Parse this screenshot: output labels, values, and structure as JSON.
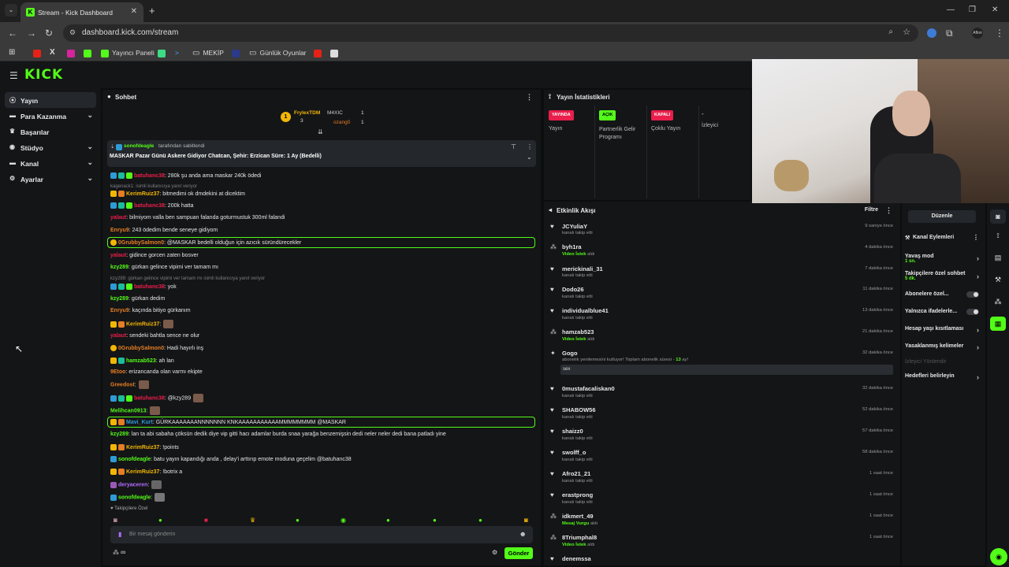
{
  "browser": {
    "tab_title": "Stream - Kick Dashboard",
    "url": "dashboard.kick.com/stream",
    "bookmarks": [
      "Yayıncı Paneli",
      "MEKİP",
      "Günlük Oyunlar"
    ]
  },
  "brand": {
    "logo": "KICK",
    "accent": "#53fc18"
  },
  "sidebar": {
    "items": [
      {
        "label": "Yayın",
        "icon": "broadcast-icon"
      },
      {
        "label": "Para Kazanma",
        "icon": "dollar-icon"
      },
      {
        "label": "Başarılar",
        "icon": "trophy-icon"
      },
      {
        "label": "Stüdyo",
        "icon": "studio-icon"
      },
      {
        "label": "Kanal",
        "icon": "channel-icon"
      },
      {
        "label": "Ayarlar",
        "icon": "gear-icon"
      }
    ]
  },
  "chat": {
    "title": "Sohbet",
    "leaderboard": [
      {
        "name": "FrylexTDM",
        "count": "3"
      },
      {
        "name": "M4XIC",
        "count": "1"
      },
      {
        "name": "ozang0",
        "count": "1"
      }
    ],
    "pinned": {
      "by": "sonofdeagle",
      "by_suffix": "tarafından sabitlendi",
      "text": "MASKAR Pazar Günü Askere Gidiyor Chatcan, Şehir: Erzican Süre: 1 Ay (Bedelli)"
    },
    "messages": [
      {
        "user": "batuhanc38",
        "text": ": 280k şu anda ama maskar 240k ödedi"
      },
      {
        "reply": "kagenack1: isimli kullanıcıya yanıt veriyor"
      },
      {
        "user": "KerimRuiz37",
        "text": ": bitmedimi ok dmdekini at dicektim"
      },
      {
        "user": "batuhanc38",
        "text": ": 200k hatta"
      },
      {
        "user": "yalaut",
        "text": ": bilmiyom valla ben sampuan falanda goturmustuk 300ml falandi"
      },
      {
        "user": "Enryu9",
        "text": ": 243 ödedim bende seneye gidiyom"
      },
      {
        "user": "0GrubbySalmon0",
        "text": ": @MASKAR bedelli olduğun için azıcık süründürecekler"
      },
      {
        "user": "yalaut",
        "text": ": gidince gorcen zaten bosver"
      },
      {
        "user": "kzy289",
        "text": ": gürkan gelince vipimi ver tamam mı"
      },
      {
        "reply": "kzy289: gürkan gelince vipimi ver tamam mı isimli kullanıcıya yanıt veriyor"
      },
      {
        "user": "batuhanc38",
        "text": ": yok"
      },
      {
        "user": "kzy289",
        "text": ": gürkan dedim"
      },
      {
        "user": "Enryu9",
        "text": ": kaçında bitiyo gürkanım"
      },
      {
        "user": "KerimRuiz37",
        "text": ":"
      },
      {
        "user": "yalaut",
        "text": ": sendeki bahtla sence ne olur"
      },
      {
        "user": "0GrubbySalmon0",
        "text": ": Hadi hayırlı inş"
      },
      {
        "user": "hamzab523",
        "text": ": ah lan"
      },
      {
        "user": "9Etoo",
        "text": ": erizancanda olan varmı ekipte"
      },
      {
        "user": "Greedost",
        "text": ":"
      },
      {
        "user": "batuhanc38",
        "text": ": @kzy289"
      },
      {
        "user": "Melihcan0913",
        "text": ":"
      },
      {
        "user": "Mavi_Kurt",
        "text": ": GÜRKAAAAAAANNNNNNN KNKAAAAAAAAAAAMMMMMMMM @MASKAR"
      },
      {
        "user": "kzy289",
        "text": ": lan ta abi sabaha çöksün dedik diye vip gitti hacı adamlar burda snaa yarağa benzemişsin dedi neler neler dedi bana patladı yine"
      },
      {
        "user": "KerimRuiz37",
        "text": ": !points"
      },
      {
        "user": "sonofdeagle",
        "text": ": batu yayın kapandığı anda , delay'i arttırıp emote moduna geçelim @batuhanc38"
      },
      {
        "user": "KerimRuiz37",
        "text": ": !botrix a"
      },
      {
        "user": "deryaceren",
        "text": ":"
      },
      {
        "user": "sonofdeagle",
        "text": ":"
      }
    ],
    "followers_only_label": "Takipçilere Özel",
    "input_placeholder": "Bir mesaj gönderin",
    "send_label": "Gönder",
    "points_label": "∞"
  },
  "stats": {
    "title": "Yayın İstatistikleri",
    "cols": [
      {
        "badge": "YAYINDA",
        "label": "Yayın",
        "color": "#e91e4b"
      },
      {
        "badge": "AÇIK",
        "label": "Partnerlik Gelir Programı",
        "color": "#53fc18"
      },
      {
        "badge": "KAPALI",
        "label": "Çoklu Yayın",
        "color": "#e91e4b"
      },
      {
        "badge": "-",
        "label": "İzleyici",
        "color": ""
      }
    ]
  },
  "activity": {
    "title": "Etkinlik Akışı",
    "filter_label": "Filtre",
    "events": [
      {
        "name": "JCYuliaY",
        "sub": "kanalı takip etti",
        "time": "9 saniye önce",
        "icon": "heart-icon"
      },
      {
        "name": "byh1ra",
        "sub": "aldı",
        "highlight": "Video İstek",
        "time": "4 dakika önce",
        "icon": "reward-icon"
      },
      {
        "name": "merickinali_31",
        "sub": "kanalı takip etti",
        "time": "7 dakika önce",
        "icon": "heart-icon"
      },
      {
        "name": "Dodo26",
        "sub": "kanalı takip etti",
        "time": "11 dakika önce",
        "icon": "heart-icon"
      },
      {
        "name": "individualblue41",
        "sub": "kanalı takip etti",
        "time": "13 dakika önce",
        "icon": "heart-icon"
      },
      {
        "name": "hamzab523",
        "sub": "aldı",
        "highlight": "Video İstek",
        "time": "21 dakika önce",
        "icon": "reward-icon"
      },
      {
        "name": "Gogo",
        "sub": "abonelik yenilemesini kutluyor! Toplam abonelik süresi -",
        "highlight_after": "13",
        "sub_after": "ay!",
        "message": "sex",
        "time": "32 dakika önce",
        "icon": "star-icon"
      },
      {
        "name": "0mustafacaliskan0",
        "sub": "kanalı takip etti",
        "time": "32 dakika önce",
        "icon": "heart-icon"
      },
      {
        "name": "SHABOW56",
        "sub": "kanalı takip etti",
        "time": "52 dakika önce",
        "icon": "heart-icon"
      },
      {
        "name": "shaizz0",
        "sub": "kanalı takip etti",
        "time": "57 dakika önce",
        "icon": "heart-icon"
      },
      {
        "name": "swolff_o",
        "sub": "kanalı takip etti",
        "time": "58 dakika önce",
        "icon": "heart-icon"
      },
      {
        "name": "Afro21_21",
        "sub": "kanalı takip etti",
        "time": "1 saat önce",
        "icon": "heart-icon"
      },
      {
        "name": "erastprong",
        "sub": "kanalı takip etti",
        "time": "1 saat önce",
        "icon": "heart-icon"
      },
      {
        "name": "idkmert_49",
        "sub": "aldı",
        "highlight": "Mesaj Vurgu",
        "time": "1 saat önce",
        "icon": "reward-icon"
      },
      {
        "name": "8Triumphal8",
        "sub": "aldı",
        "highlight": "Video İstek",
        "time": "1 saat önce",
        "icon": "reward-icon"
      },
      {
        "name": "denemssa",
        "sub": "",
        "time": "",
        "icon": "heart-icon"
      }
    ]
  },
  "channel_actions": {
    "edit_label": "Düzenle",
    "title": "Kanal Eylemleri",
    "items": [
      {
        "label": "Yavaş mod",
        "sub": "1 sn.",
        "type": "chevron"
      },
      {
        "label": "Takipçilere özel sohbet",
        "sub": "5 dk.",
        "type": "chevron"
      },
      {
        "label": "Abonelere özel...",
        "type": "toggle"
      },
      {
        "label": "Yalnızca ifadelerle...",
        "type": "toggle"
      },
      {
        "label": "Hesap yaşı kısıtlaması",
        "type": "chevron"
      },
      {
        "label": "Yasaklanmış kelimeler",
        "type": "chevron"
      },
      {
        "label": "İzleyici Yönlendir",
        "type": "disabled"
      },
      {
        "label": "Hedefleri belirleyin",
        "type": "chevron"
      }
    ]
  }
}
